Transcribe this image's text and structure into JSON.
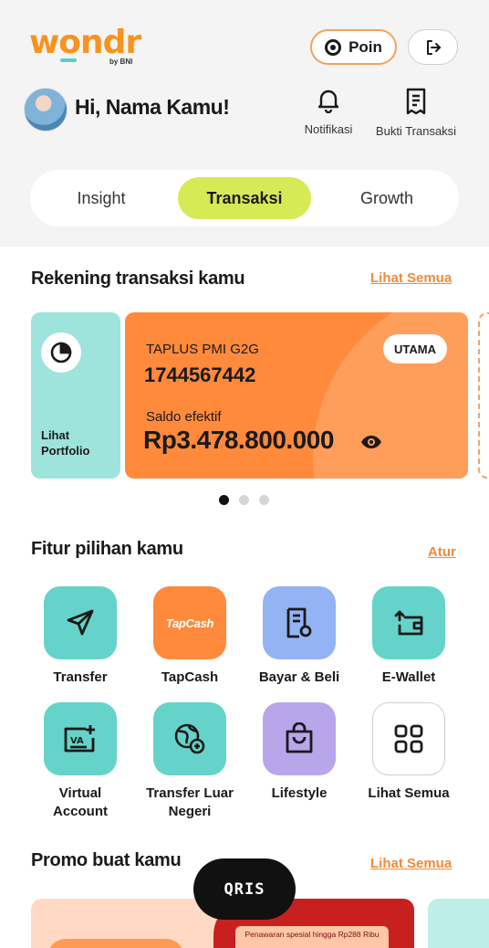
{
  "brand": {
    "logo_text": "wondr",
    "logo_sub": "by BNI",
    "accent": "#f7931e",
    "teal": "#57d0c4"
  },
  "header": {
    "poin_label": "Poin",
    "greeting": "Hi, Nama Kamu!",
    "notif_label": "Notifikasi",
    "bukti_label": "Bukti Transaksi",
    "icons": {
      "poin": "eye-ring-icon",
      "logout": "logout-icon",
      "notif": "bell-icon",
      "bukti": "receipt-icon"
    }
  },
  "tabs": [
    {
      "label": "Insight",
      "active": false
    },
    {
      "label": "Transaksi",
      "active": true
    },
    {
      "label": "Growth",
      "active": false
    }
  ],
  "rekening": {
    "title": "Rekening transaksi kamu",
    "see_all": "Lihat Semua",
    "portfolio_label_1": "Lihat",
    "portfolio_label_2": "Portfolio",
    "account": {
      "name": "TAPLUS PMI G2G",
      "number": "1744567442",
      "badge": "UTAMA",
      "saldo_label": "Saldo efektif",
      "saldo": "Rp3.478.800.000"
    },
    "carousel": {
      "pages": 3,
      "active": 0
    }
  },
  "fitur": {
    "title": "Fitur pilihan kamu",
    "action": "Atur",
    "items": [
      {
        "label": "Transfer",
        "icon": "send-icon"
      },
      {
        "label": "TapCash",
        "icon": "tapcash-icon",
        "logo_text": "TapCash"
      },
      {
        "label": "Bayar & Beli",
        "icon": "bill-icon"
      },
      {
        "label": "E-Wallet",
        "icon": "wallet-icon"
      },
      {
        "label": "Virtual Account",
        "icon": "va-icon",
        "icon_text": "VA"
      },
      {
        "label": "Transfer Luar Negeri",
        "icon": "globe-transfer-icon"
      },
      {
        "label": "Lifestyle",
        "icon": "shopping-bag-icon"
      },
      {
        "label": "Lihat Semua",
        "icon": "grid-icon"
      }
    ]
  },
  "promo": {
    "title": "Promo buat kamu",
    "see_all": "Lihat Semua",
    "banner_text": "Penawaran spesial hingga Rp288 Ribu"
  },
  "fab": {
    "label": "QRIS"
  }
}
